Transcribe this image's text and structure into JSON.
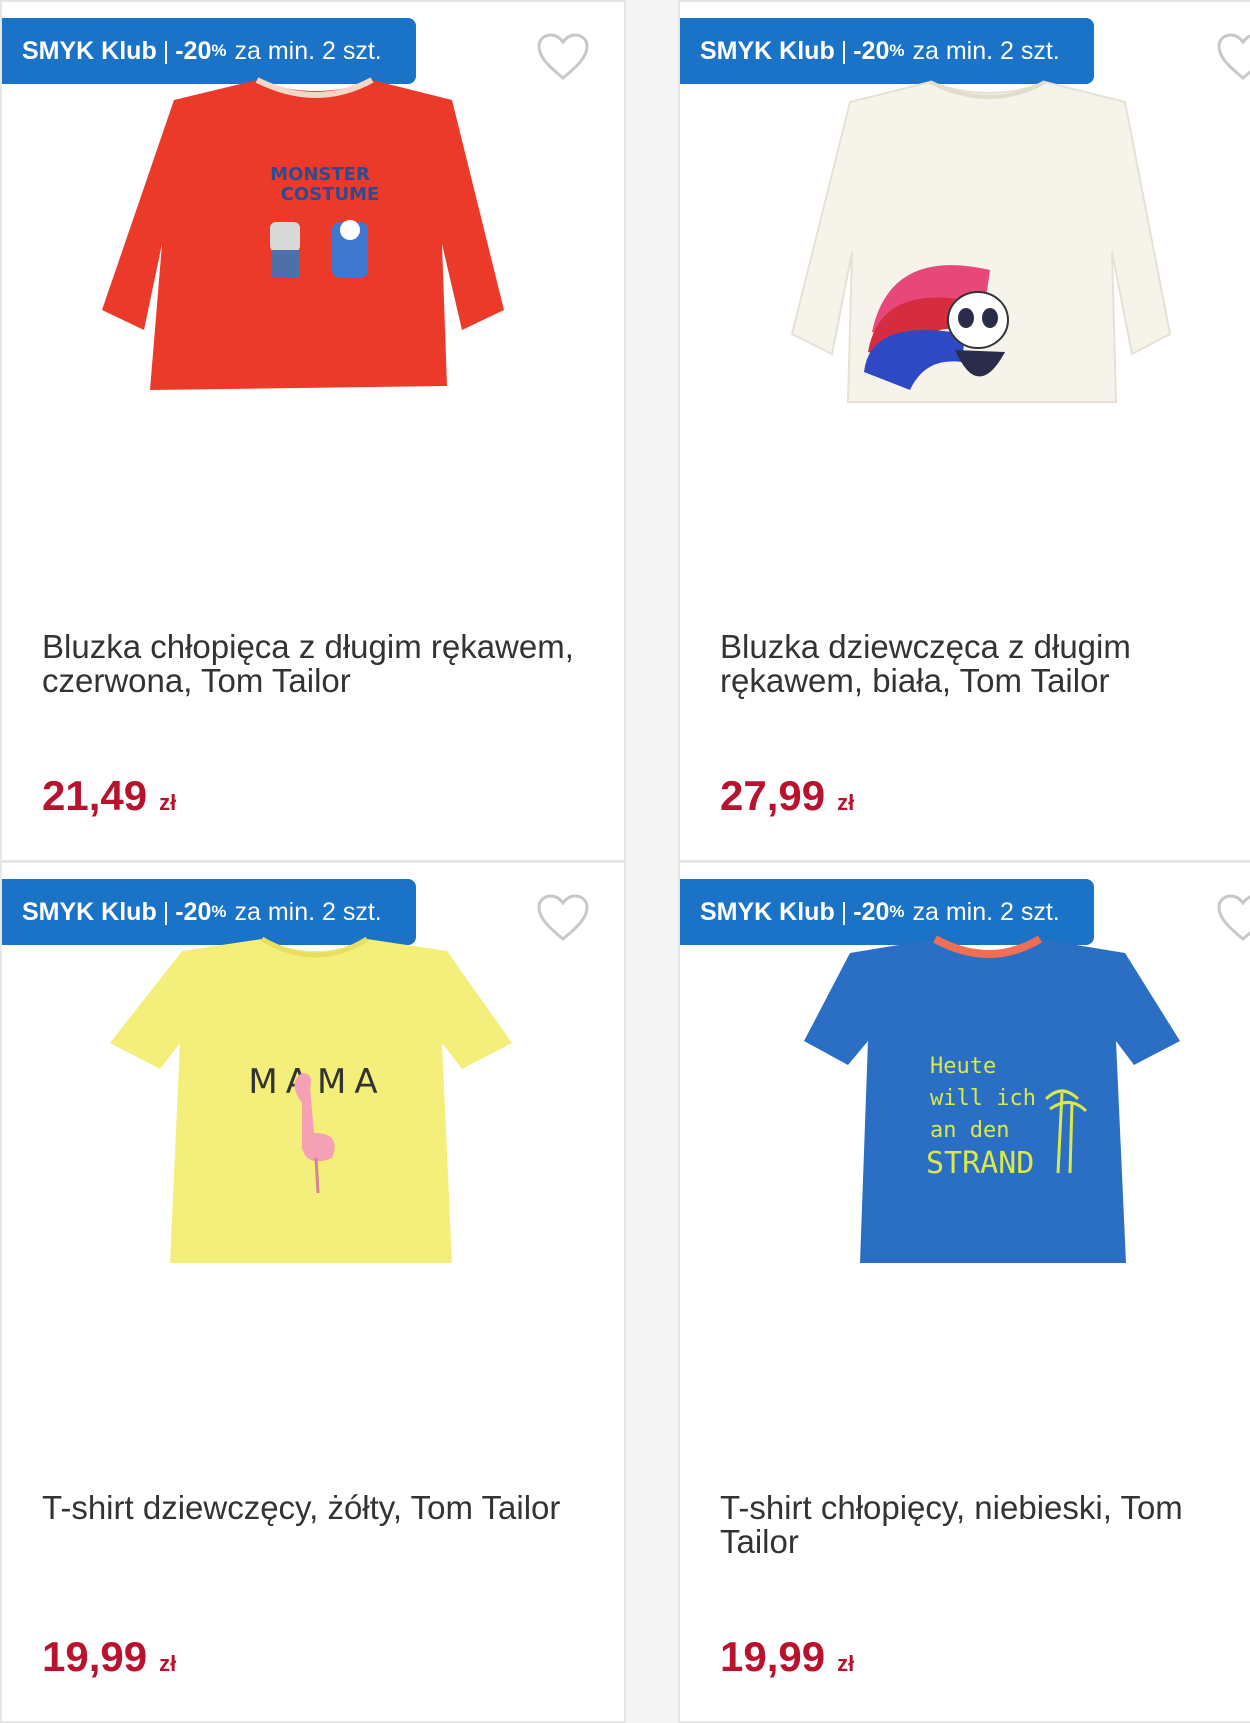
{
  "colors": {
    "promo_bg": "#1a73c6",
    "price": "#b8122e"
  },
  "products": [
    {
      "promo": {
        "brand": "SMYK Klub",
        "sep": "|",
        "discount": "-20",
        "pct": "%",
        "rest": "za min. 2 szt."
      },
      "title": "Bluzka chłopięca z długim rękawem, czerwona, Tom Tailor",
      "price": "21,49",
      "currency": "zł",
      "image": {
        "kind": "long-sleeve",
        "color": "#ec3a2a",
        "print": [
          "MONSTER",
          "COSTUME"
        ]
      }
    },
    {
      "promo": {
        "brand": "SMYK Klub",
        "sep": "|",
        "discount": "-20",
        "pct": "%",
        "rest": "za min. 2 szt."
      },
      "title": "Bluzka dziewczęca z długim rękawem, biała, Tom Tailor",
      "price": "27,99",
      "currency": "zł",
      "image": {
        "kind": "long-sleeve",
        "color": "#f6f3ea",
        "print": []
      }
    },
    {
      "promo": {
        "brand": "SMYK Klub",
        "sep": "|",
        "discount": "-20",
        "pct": "%",
        "rest": "za min. 2 szt."
      },
      "title": "T-shirt dziewczęcy, żółty, Tom Tailor",
      "price": "19,99",
      "currency": "zł",
      "image": {
        "kind": "tee",
        "color": "#f4ee7a",
        "print": [
          "MAMA"
        ]
      }
    },
    {
      "promo": {
        "brand": "SMYK Klub",
        "sep": "|",
        "discount": "-20",
        "pct": "%",
        "rest": "za min. 2 szt."
      },
      "title": "T-shirt chłopięcy, niebieski, Tom Tailor",
      "price": "19,99",
      "currency": "zł",
      "image": {
        "kind": "tee",
        "color": "#2a6fc4",
        "print": [
          "Heute",
          "will ich",
          "an den",
          "STRAND"
        ]
      }
    }
  ]
}
